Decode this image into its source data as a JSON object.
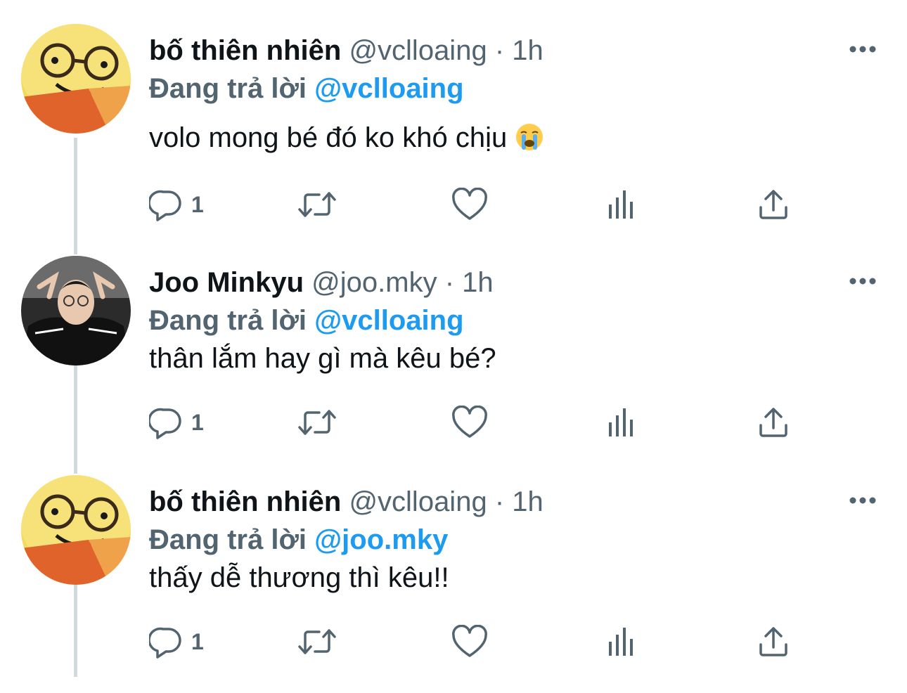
{
  "colors": {
    "text": "#0f1419",
    "secondary": "#536471",
    "accent": "#1d9bf0",
    "thread": "#cfd9de"
  },
  "replying_label": "Đang trả lời",
  "tweets": [
    {
      "name": "bố thiên nhiên",
      "handle": "@vclloaing",
      "time": "1h",
      "reply_to": "@vclloaing",
      "text": "volo mong bé đó ko khó chịu",
      "emoji": "loudly-crying-face",
      "reply_count": "1",
      "avatar": "yellow-plush-with-glasses-avatar"
    },
    {
      "name": "Joo Minkyu",
      "handle": "@joo.mky",
      "time": "1h",
      "reply_to": "@vclloaing",
      "text": "thân lắm hay gì mà kêu bé?",
      "reply_count": "1",
      "avatar": "person-photo-avatar"
    },
    {
      "name": "bố thiên nhiên",
      "handle": "@vclloaing",
      "time": "1h",
      "reply_to": "@joo.mky",
      "text": "thấy dễ thương thì kêu!!",
      "reply_count": "1",
      "avatar": "yellow-plush-with-glasses-avatar"
    }
  ],
  "icons": [
    "reply-icon",
    "retweet-icon",
    "like-icon",
    "analytics-icon",
    "share-icon",
    "more-icon"
  ]
}
